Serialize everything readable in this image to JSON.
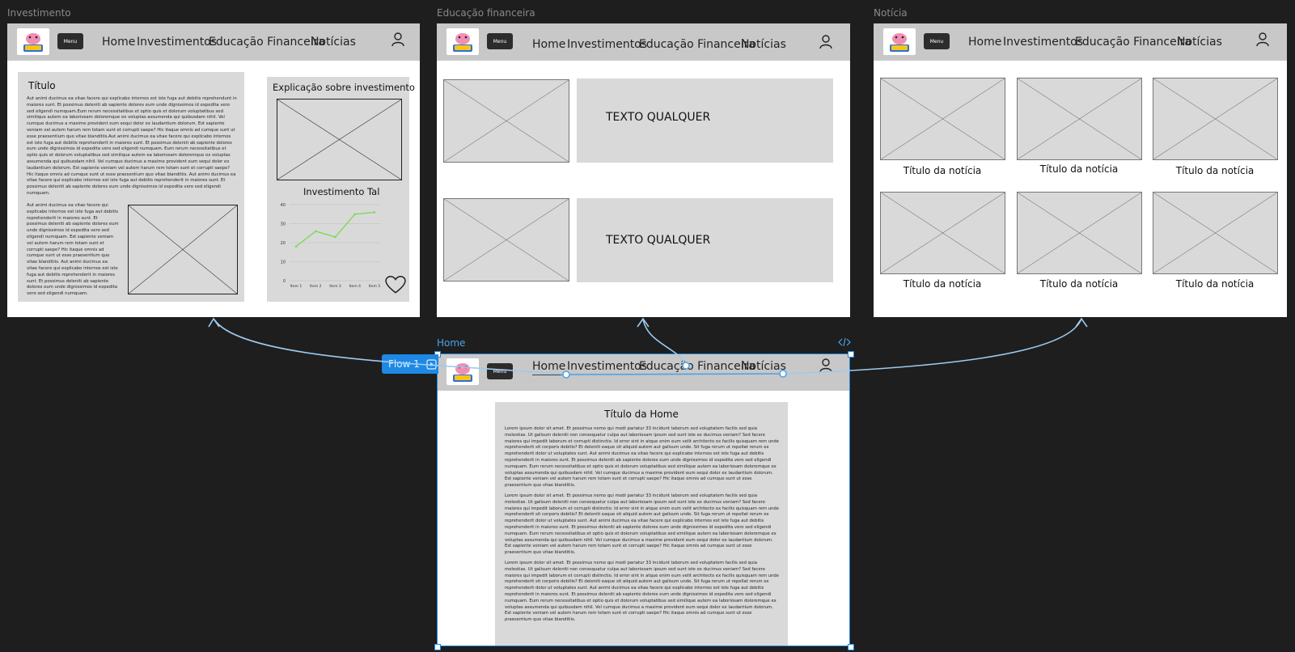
{
  "frames": {
    "investimento": "Investimento",
    "educacao": "Educação financeira",
    "noticia": "Notícia",
    "home": "Home"
  },
  "nav": {
    "menu": "Menu",
    "links": [
      "Home",
      "Investimentos",
      "Educação Financeira",
      "Notícias"
    ]
  },
  "investimento": {
    "title": "Título",
    "body_text": "Aut animi ducimus ea vitae facere qui explicabo internos est iste fuga aut debitis reprehendunt in maiores sunt. Et possimus deleniti ab sapiente dolores eum unde dignissimos id expedita vero sed eligendi numquam.Eum rerum necessitatibus et optio quis et dolorum voluptatibus sed similique autem ea laboriosam doloremque ex voluptas assumenda qui quibusdam nihil. Vel cumque ducimus a maxime provident eum sequi dolor ex laudantium dolorum. Est sapiente veniam vel autem harum rem totam sunt et corrupti saepe? Hic itaque omnis ad cumque sunt ut esse praesentium quo vitae blanditiis.Aut animi ducimus ea vitae facere qui explicabo internos est iste fuga aut debitis reprehenderit in maiores sunt. Et possimus deleniti ab sapiente dolores eum unde dignissimos id expedita vero sed eligendi numquam. Eum rerum necessitatibus et optio quis et dolorum voluptatibus sed similique autem ea laboriosam doloremque ex voluptas assumenda qui quibusdam nihil. Vel cumque ducimus a maxime provident eum sequi dolor ex laudantium dolorum. Est sapiente veniam vel autem harum rem totam sunt et corrupti saepe? Hic itaque omnis ad cumque sunt ut esse praesentium quo vitae blanditiis. Aut animi ducimus ea vitae facere qui explicabo internos est iste fuga aut debitis reprehenderit in maiores sunt. Et possimus deleniti ab sapiente dolores eum unde dignissimos id expedita vero sed eligendi numquam.",
    "side_text": "Aut animi ducimus ea vitae facere qui explicabo internos est iste fuga aut debitis reprehenderit in maiores sunt. Et possimus deleniti ab sapiente dolores eum unde dignissimos id expedita vero sed eligendi numquam. Est sapiente veniam vel autem harum rem totam sunt et corrupti saepe? Hic itaque omnis ad cumque sunt ut esse praesentium quo vitae blanditiis. Aut animi ducimus ea vitae facere qui explicabo internos est iste fuga aut debitis reprehenderit in maiores sunt. Et possimus deleniti ab sapiente dolores eum unde dignissimos id expedita vero sed eligendi numquam.",
    "sidebar_title": "Explicação sobre investimento",
    "chart_title": "Investimento Tal"
  },
  "chart_data": {
    "type": "line",
    "title": "Investimento Tal",
    "categories": [
      "Item 1",
      "Item 2",
      "Item 3",
      "Item 4",
      "Item 5"
    ],
    "values": [
      18,
      26,
      23,
      35,
      36
    ],
    "ylim": [
      0,
      40
    ],
    "yticks": [
      0,
      10,
      20,
      30,
      40
    ],
    "grid": true,
    "color": "#7ed957"
  },
  "educacao": {
    "items": [
      "TEXTO QUALQUER",
      "TEXTO QUALQUER"
    ]
  },
  "noticia": {
    "captions": [
      "Título da notícia",
      "Título da notícia",
      "Título da notícia",
      "Título da notícia",
      "Título da notícia",
      "Título da notícia"
    ]
  },
  "home": {
    "title": "Título da Home",
    "paragraphs": [
      "Lorem ipsum dolor sit amet. Et possimus nemo qui modi pariatur 33 incidunt laborum sed voluptatem facilis sed quia molestias. Ut galisum deleniti non consequatur culpa aut laboriosam ipsum sed sunt iste ex ducimus veniam? Sed facere maiores qui impedit laborum et corrupti distinctio. Id error sint in atque enim eum velit architecto ex facilis quisquam rem unde reprehenderit sit corporis debitis? Et deleniti eaque sit aliquid autem aut galisum unde. Sit fuga rerum ut repellat rerum ex reprehenderit dolor ut voluptates sunt. Aut animi ducimus ea vitae facere qui explicabo internos est iste fuga aut debitis reprehenderit in maiores sunt. Et possimus deleniti ab sapiente dolores eum unde dignissimos id expedita vero sed eligendi numquam. Eum rerum necessitatibus et optio quis et dolorum voluptatibus sed similique autem ea laboriosam doloremque ex voluptas assumenda qui quibusdam nihil. Vel cumque ducimus a maxime provident eum sequi dolor ex laudantium dolorum. Est sapiente veniam vel autem harum rem totam sunt et corrupti saepe? Hic itaque omnis ad cumque sunt ut esse praesentium quo vitae blanditiis.",
      "Lorem ipsum dolor sit amet. Et possimus nemo qui modi pariatur 33 incidunt laborum sed voluptatem facilis sed quia molestias. Ut galisum deleniti non consequatur culpa aut laboriosam ipsum sed sunt iste ex ducimus veniam? Sed facere maiores qui impedit laborum et corrupti distinctio. Id error sint in atque enim eum velit architecto ex facilis quisquam rem unde reprehenderit sit corporis debitis? Et deleniti eaque sit aliquid autem aut galisum unde. Sit fuga rerum ut repellat rerum ex reprehenderit dolor ut voluptates sunt. Aut animi ducimus ea vitae facere qui explicabo internos est iste fuga aut debitis reprehenderit in maiores sunt. Et possimus deleniti ab sapiente dolores eum unde dignissimos id expedita vero sed eligendi numquam. Eum rerum necessitatibus et optio quis et dolorum voluptatibus sed similique autem ea laboriosam doloremque ex voluptas assumenda qui quibusdam nihil. Vel cumque ducimus a maxime provident eum sequi dolor ex laudantium dolorum. Est sapiente veniam vel autem harum rem totam sunt et corrupti saepe? Hic itaque omnis ad cumque sunt ut esse praesentium quo vitae blanditiis.",
      "Lorem ipsum dolor sit amet. Et possimus nemo qui modi pariatur 33 incidunt laborum sed voluptatem facilis sed quia molestias. Ut galisum deleniti non consequatur culpa aut laboriosam ipsum sed sunt iste ex ducimus veniam? Sed facere maiores qui impedit laborum et corrupti distinctio. Id error sint in atque enim eum velit architecto ex facilis quisquam rem unde reprehenderit sit corporis debitis? Et deleniti eaque sit aliquid autem aut galisum unde. Sit fuga rerum ut repellat rerum ex reprehenderit dolor ut voluptates sunt. Aut animi ducimus ea vitae facere qui explicabo internos est iste fuga aut debitis reprehenderit in maiores sunt. Et possimus deleniti ab sapiente dolores eum unde dignissimos id expedita vero sed eligendi numquam. Eum rerum necessitatibus et optio quis et dolorum voluptatibus sed similique autem ea laboriosam doloremque ex voluptas assumenda qui quibusdam nihil. Vel cumque ducimus a maxime provident eum sequi dolor ex laudantium dolorum. Est sapiente veniam vel autem harum rem totam sunt et corrupti saepe? Hic itaque omnis ad cumque sunt ut esse praesentium quo vitae blanditiis."
    ]
  },
  "flow": {
    "label": "Flow 1"
  },
  "icons": [
    "user-icon",
    "heart-icon",
    "code-icon",
    "play-icon",
    "image-placeholder-icon"
  ],
  "colors": {
    "canvas": "#1e1e1e",
    "frame": "#ffffff",
    "nav": "#c8c8c8",
    "placeholder": "#d9d9d9",
    "selection": "#1e88e5",
    "connector": "#9ccaf0"
  }
}
